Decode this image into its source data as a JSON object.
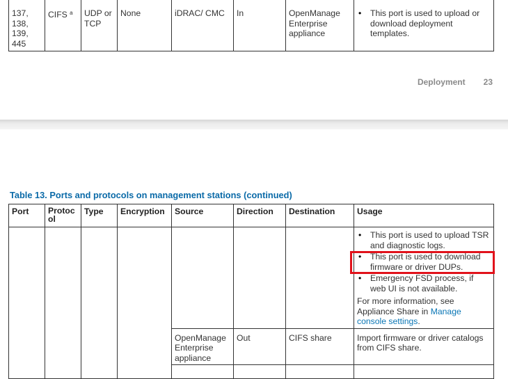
{
  "top_table": {
    "row": {
      "port": "137,\n138,\n139,\n445",
      "protocol": "CIFS",
      "protocol_sup": "a",
      "type": "UDP or TCP",
      "encryption": "None",
      "source": "iDRAC/ CMC",
      "direction": "In",
      "destination": "OpenManage Enterprise appliance",
      "usage": "This port is used to upload or download deployment templates."
    }
  },
  "footer": {
    "section": "Deployment",
    "page_number": "23"
  },
  "table_title": "Table 13. Ports and protocols on management stations (continued)",
  "headers": [
    "Port",
    "Protoc ol",
    "Type",
    "Encryption",
    "Source",
    "Direction",
    "Destination",
    "Usage"
  ],
  "rows": [
    {
      "port": "",
      "protocol": "",
      "type": "",
      "encryption": "",
      "source": "",
      "direction": "",
      "destination": "",
      "usage_bullets": [
        "This port is used to upload TSR and diagnostic logs.",
        "This port is used to download firmware or driver DUPs.",
        "Emergency FSD process, if web UI is not available."
      ],
      "usage_note": "For more information, see Appliance Share in",
      "usage_link": "Manage console settings",
      "usage_end": "."
    },
    {
      "source": "OpenManage Enterprise appliance",
      "direction": "Out",
      "destination": "CIFS share",
      "usage": "Import firmware or driver catalogs from CIFS share."
    }
  ],
  "highlight_color": "#e1121b",
  "title_color": "#0a6aa8",
  "link_color": "#0a76b5"
}
